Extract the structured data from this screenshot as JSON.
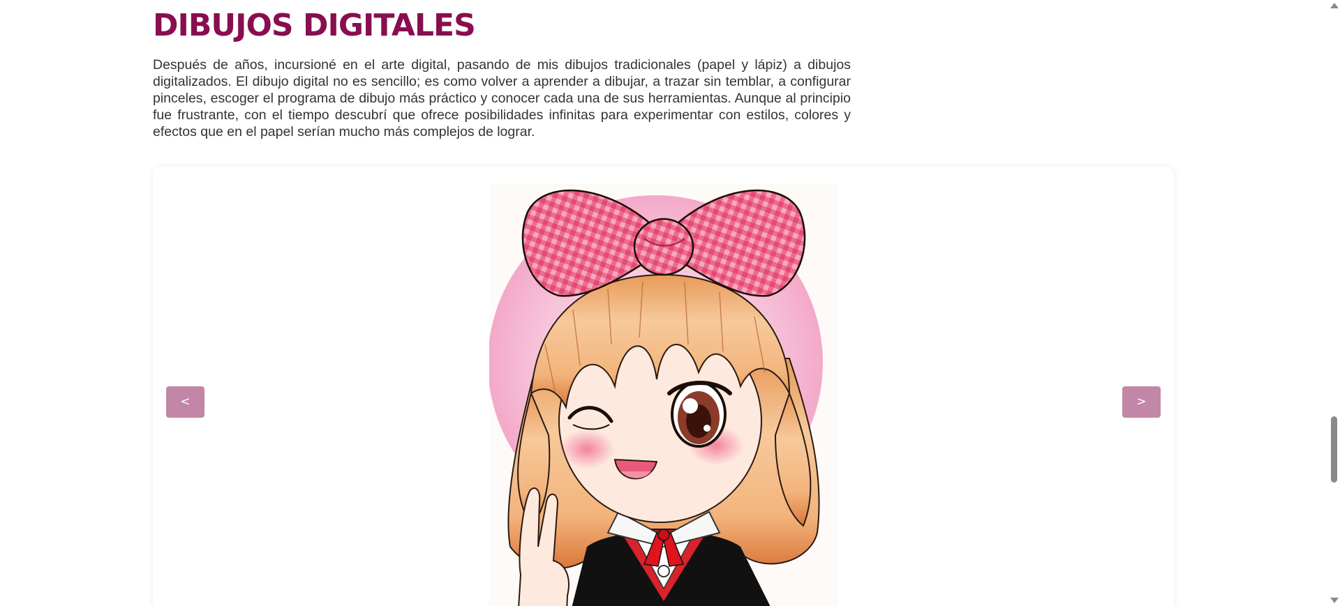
{
  "section": {
    "title": "DIBUJOS DIGITALES",
    "description": "Después de años, incursioné en el arte digital, pasando de mis dibujos tradicionales (papel y lápiz) a dibujos digitalizados. El dibujo digital no es sencillo; es como volver a aprender a dibujar, a trazar sin temblar, a configurar pinceles, escoger el programa de dibujo más práctico y conocer cada una de sus herramientas. Aunque al principio fue frustrante, con el tiempo descubrí que ofrece posibilidades infinitas para experimentar con estilos, colores y efectos que en el papel serían mucho más complejos de lograr."
  },
  "carousel": {
    "prev_label": "<",
    "next_label": ">",
    "image_alt": "chibi girl with pink bow winking and making peace sign"
  },
  "colors": {
    "title": "#880e4f",
    "button": "#c287a7",
    "text": "#333333"
  }
}
